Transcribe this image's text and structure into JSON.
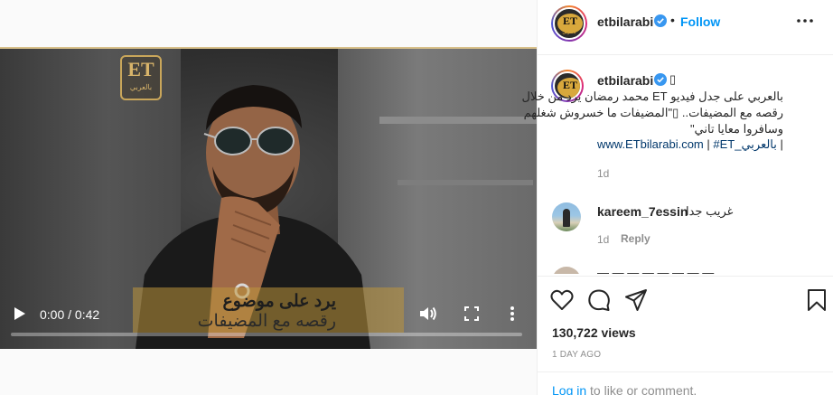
{
  "video": {
    "watermark_main": "ET",
    "watermark_sub": "بالعربي",
    "caption_line1": "يرد على موضوع",
    "caption_line2": "رقصه مع المضيفات",
    "time": "0:00 / 0:42",
    "progress_fraction": 0.0
  },
  "header": {
    "username": "etbilarabi",
    "dot": "•",
    "follow": "Follow"
  },
  "caption": {
    "username": "etbilarabi",
    "glyph": "▯",
    "lines": [
      "بالعربي على جدل فيديو ET محمد رمضان يرد من خلال",
      "رقصه مع المضيفات.. ▯\"المضيفات ما خسروش شغلهم",
      "وسافروا معايا تاني\""
    ],
    "link_site": "www.ETbilarabi.com",
    "sep1": " | ",
    "link_tag": "#ET_بالعربي",
    "sep2": " |",
    "time": "1d"
  },
  "comments": [
    {
      "username": "kareem_7essin",
      "text": "غريب جدا",
      "time": "1d",
      "reply": "Reply"
    },
    {
      "text_partial": "— — — — — — — —",
      "text_partial_b": "ـــ ـــ ــــ ـــــ"
    }
  ],
  "stats": {
    "views": "130,722 views",
    "time_ago": "1 DAY AGO"
  },
  "login": {
    "link": "Log in",
    "rest": " to like or comment."
  },
  "colors": {
    "accent": "#0095f6",
    "verified": "#3897f0",
    "muted": "#8e8e8e",
    "watermark_gold": "#c9a65a"
  },
  "icons": [
    "play-icon",
    "volume-icon",
    "fullscreen-icon",
    "more-vertical-icon",
    "verified-badge-icon",
    "more-horizontal-icon",
    "heart-icon",
    "comment-icon",
    "share-icon",
    "bookmark-icon"
  ]
}
